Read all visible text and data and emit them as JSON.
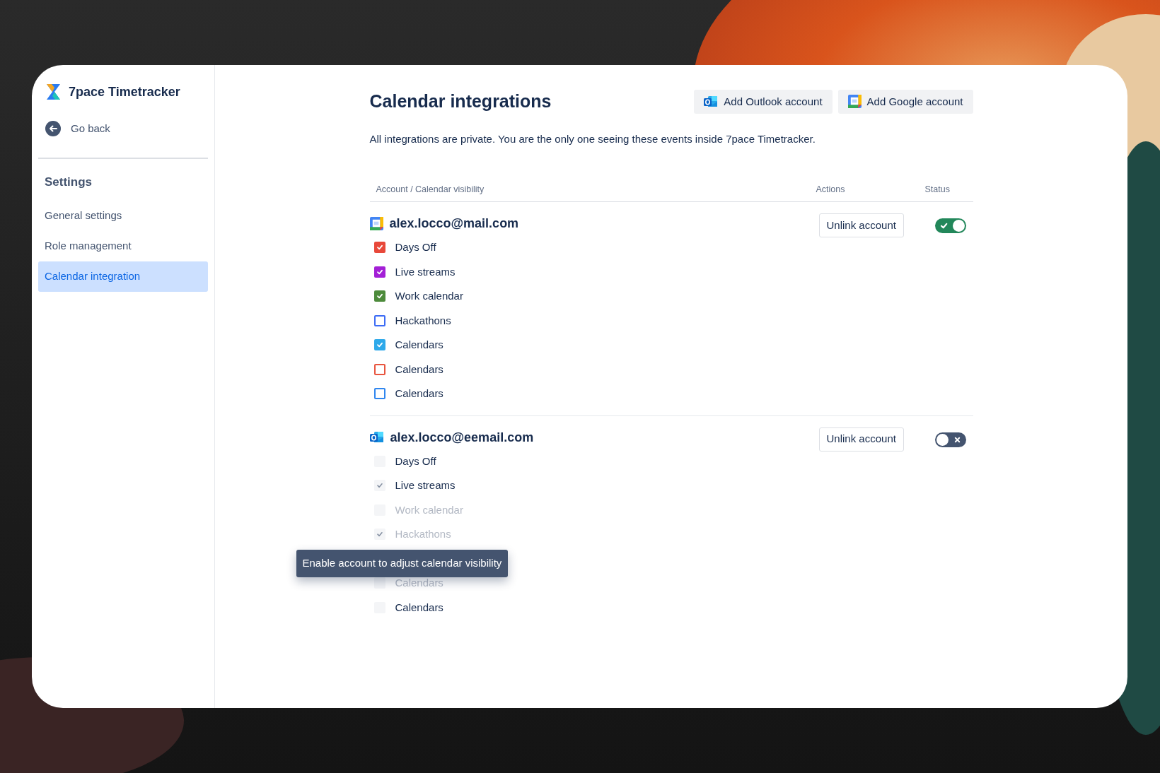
{
  "sidebar": {
    "app_name": "7pace Timetracker",
    "back": "Go back",
    "section_title": "Settings",
    "items": [
      {
        "label": "General settings",
        "selected": false
      },
      {
        "label": "Role management",
        "selected": false
      },
      {
        "label": "Calendar integration",
        "selected": true
      }
    ]
  },
  "header": {
    "title": "Calendar integrations",
    "buttons": [
      {
        "label": "Add Outlook account",
        "kind": "outlook"
      },
      {
        "label": "Add Google account",
        "kind": "google"
      }
    ],
    "description": "All integrations are private. You are the only one seeing these events inside 7pace Timetracker."
  },
  "table": {
    "columns": [
      "Account / Calendar visibility",
      "Actions",
      "Status"
    ],
    "accounts": [
      {
        "email": "alex.locco@mail.com",
        "kind": "google",
        "action": "Unlink account",
        "on": true,
        "calendars": [
          {
            "label": "Days Off",
            "checked": true,
            "color": "#e8483a"
          },
          {
            "label": "Live streams",
            "checked": true,
            "color": "#a31fd6"
          },
          {
            "label": "Work calendar",
            "checked": true,
            "color": "#4d8b3b"
          },
          {
            "label": "Hackathons",
            "checked": false,
            "color": "#3d6cf5"
          },
          {
            "label": "Calendars",
            "checked": true,
            "color": "#2ea9ea"
          },
          {
            "label": "Calendars",
            "checked": false,
            "color": "#e8553f"
          },
          {
            "label": "Calendars",
            "checked": false,
            "color": "#2f86ef"
          }
        ]
      },
      {
        "email": "alex.locco@eemail.com",
        "kind": "outlook",
        "action": "Unlink account",
        "on": false,
        "calendars": [
          {
            "label": "Days Off",
            "checked": false,
            "faded": false
          },
          {
            "label": "Live streams",
            "checked": true,
            "faded": false
          },
          {
            "label": "Work calendar",
            "checked": false,
            "faded": true
          },
          {
            "label": "Hackathons",
            "checked": true,
            "faded": true
          },
          {
            "kind": "hidden"
          },
          {
            "label": "Calendars",
            "checked": false,
            "faded": true
          },
          {
            "label": "Calendars",
            "checked": false,
            "faded": false
          }
        ],
        "tooltip": "Enable account to adjust calendar visibility"
      }
    ]
  }
}
